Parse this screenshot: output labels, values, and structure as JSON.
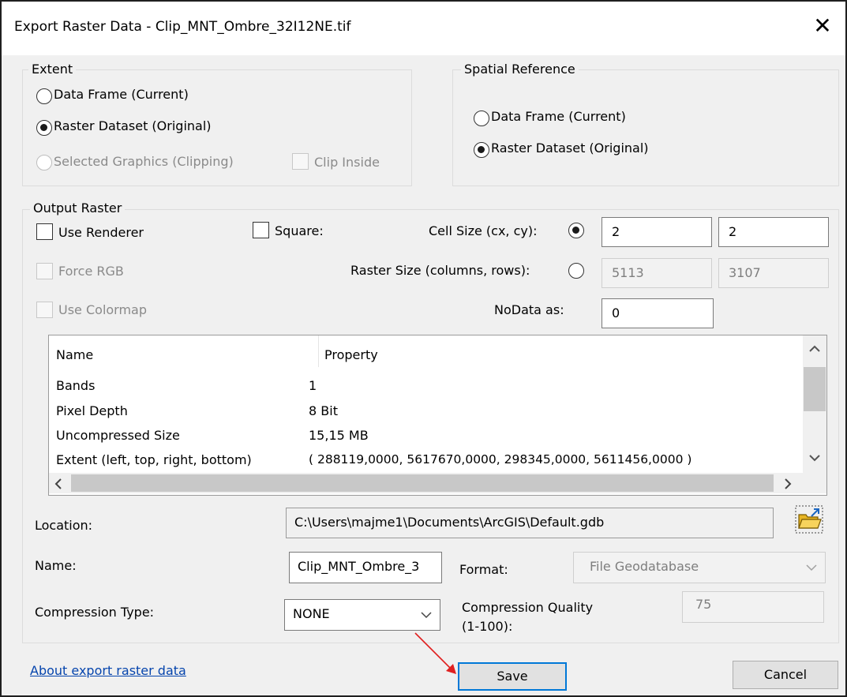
{
  "window": {
    "title": "Export Raster Data - Clip_MNT_Ombre_32I12NE.tif",
    "close_label": "✕"
  },
  "extent": {
    "legend": "Extent",
    "opt_data_frame": "Data Frame (Current)",
    "opt_raster_dataset": "Raster Dataset (Original)",
    "opt_selected_graphics": "Selected Graphics (Clipping)",
    "clip_inside": "Clip Inside"
  },
  "spatial_ref": {
    "legend": "Spatial Reference",
    "opt_data_frame": "Data Frame (Current)",
    "opt_raster_dataset": "Raster Dataset (Original)"
  },
  "output": {
    "legend": "Output Raster",
    "use_renderer": "Use Renderer",
    "force_rgb": "Force RGB",
    "use_colormap": "Use Colormap",
    "square": "Square:",
    "cell_size_label": "Cell Size (cx, cy):",
    "cell_cx": "2",
    "cell_cy": "2",
    "raster_size_label": "Raster Size (columns, rows):",
    "columns": "5113",
    "rows": "3107",
    "nodata_label": "NoData as:",
    "nodata_value": "0"
  },
  "props": {
    "headers": [
      "Name",
      "Property"
    ],
    "rows": [
      [
        "Bands",
        "1"
      ],
      [
        "Pixel Depth",
        "8 Bit"
      ],
      [
        "Uncompressed Size",
        "15,15 MB"
      ],
      [
        "Extent (left, top, right, bottom)",
        "( 288119,0000, 5617670,0000, 298345,0000, 5611456,0000 )"
      ]
    ]
  },
  "form": {
    "location_label": "Location:",
    "location_value": "C:\\Users\\majme1\\Documents\\ArcGIS\\Default.gdb",
    "name_label": "Name:",
    "name_value": "Clip_MNT_Ombre_3",
    "format_label": "Format:",
    "format_value": "File Geodatabase",
    "compression_type_label": "Compression Type:",
    "compression_type_value": "NONE",
    "compression_quality_label_1": "Compression Quality",
    "compression_quality_label_2": "(1-100):",
    "compression_quality_value": "75"
  },
  "footer": {
    "about_link": "About export raster data",
    "save": "Save",
    "cancel": "Cancel"
  },
  "colors": {
    "accent": "#0078d7",
    "arrow": "#e02020",
    "link": "#0645ad"
  }
}
